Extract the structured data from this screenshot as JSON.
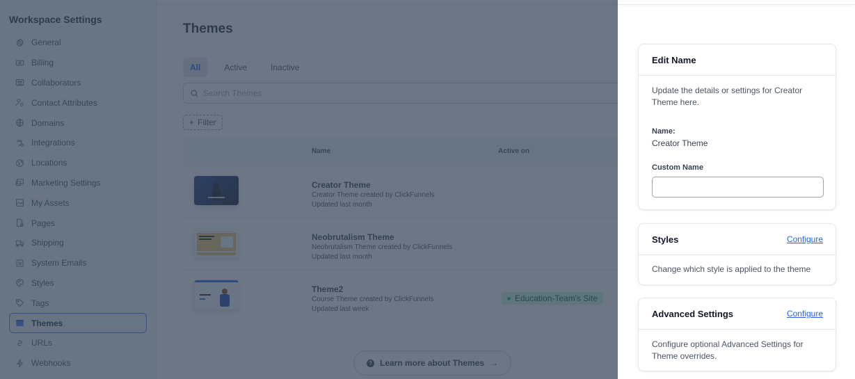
{
  "sidebar": {
    "title": "Workspace Settings",
    "items": [
      {
        "label": "General",
        "icon": "gear-icon"
      },
      {
        "label": "Billing",
        "icon": "money-icon"
      },
      {
        "label": "Collaborators",
        "icon": "users-icon"
      },
      {
        "label": "Contact Attributes",
        "icon": "contact-settings-icon"
      },
      {
        "label": "Domains",
        "icon": "globe-icon"
      },
      {
        "label": "Integrations",
        "icon": "plug-icon"
      },
      {
        "label": "Locations",
        "icon": "location-globe-icon"
      },
      {
        "label": "Marketing Settings",
        "icon": "marketing-icon"
      },
      {
        "label": "My Assets",
        "icon": "image-icon"
      },
      {
        "label": "Pages",
        "icon": "page-icon"
      },
      {
        "label": "Shipping",
        "icon": "truck-icon"
      },
      {
        "label": "System Emails",
        "icon": "email-icon"
      },
      {
        "label": "Styles",
        "icon": "palette-icon"
      },
      {
        "label": "Tags",
        "icon": "tag-icon"
      },
      {
        "label": "Themes",
        "icon": "theme-icon",
        "active": true
      },
      {
        "label": "URLs",
        "icon": "link-icon"
      },
      {
        "label": "Webhooks",
        "icon": "bolt-icon"
      }
    ]
  },
  "main": {
    "title": "Themes",
    "tabs": [
      {
        "label": "All",
        "active": true
      },
      {
        "label": "Active"
      },
      {
        "label": "Inactive"
      }
    ],
    "search_placeholder": "Search Themes",
    "filter_label": "Filter",
    "table": {
      "columns": [
        "Name",
        "Active on"
      ],
      "rows": [
        {
          "title": "Creator Theme",
          "subtitle": "Creator Theme created by ClickFunnels",
          "updated": "Updated last month",
          "active_on": null,
          "thumbnail": "creator-thumbnail"
        },
        {
          "title": "Neobrutalism Theme",
          "subtitle": "Neobrutalism Theme created by ClickFunnels",
          "updated": "Updated last month",
          "active_on": null,
          "thumbnail": "neobrutalism-thumbnail"
        },
        {
          "title": "Theme2",
          "subtitle": "Course Theme created by ClickFunnels",
          "updated": "Updated last week",
          "active_on": "Education-Team's Site",
          "thumbnail": "course-thumbnail"
        }
      ]
    },
    "learn_more_label": "Learn more about Themes"
  },
  "drawer": {
    "edit_name": {
      "title": "Edit Name",
      "description": "Update the details or settings for Creator Theme here.",
      "name_label": "Name:",
      "name_value": "Creator Theme",
      "custom_name_label": "Custom Name",
      "custom_name_value": ""
    },
    "styles": {
      "title": "Styles",
      "link_label": "Configure",
      "description": "Change which style is applied to the theme"
    },
    "advanced": {
      "title": "Advanced Settings",
      "link_label": "Configure",
      "description": "Configure optional Advanced Settings for Theme overrides."
    }
  },
  "colors": {
    "accent": "#2563eb",
    "overlay": "#667085",
    "badge_bg": "#d1fae5",
    "badge_dot": "#10b981"
  }
}
